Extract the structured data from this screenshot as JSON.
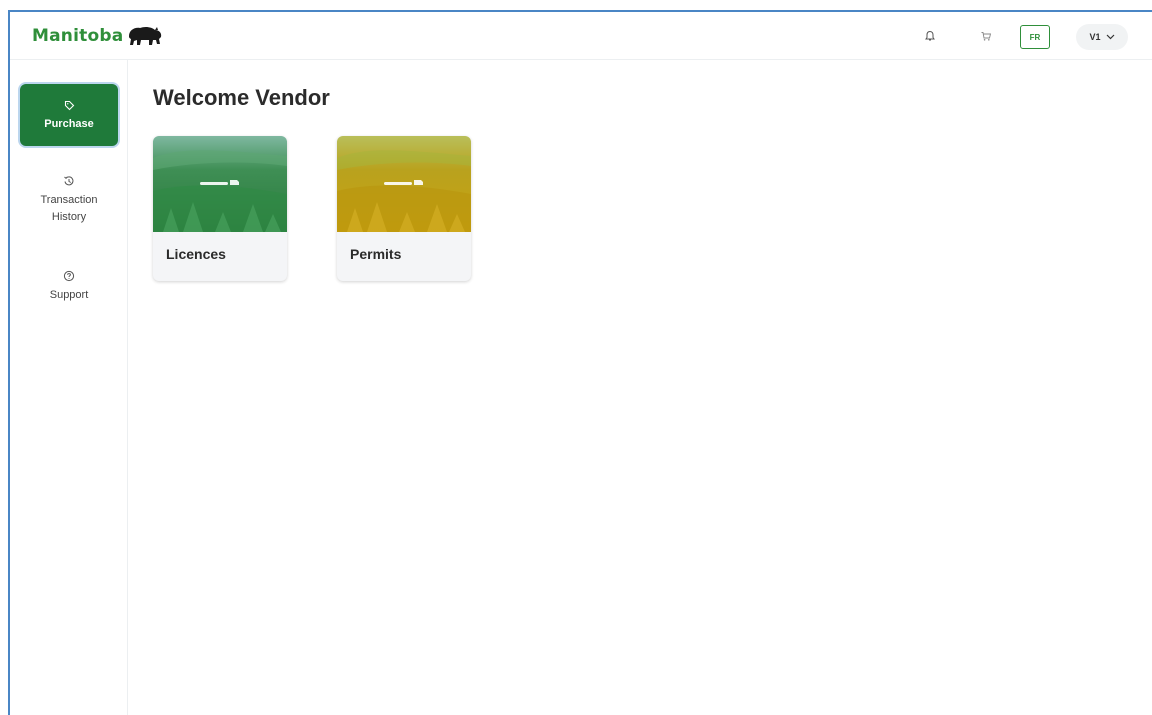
{
  "header": {
    "brand": "Manitoba",
    "bell_icon": "bell-icon",
    "cart_icon": "cart-icon",
    "language_button": "FR",
    "user_button": "V1"
  },
  "sidebar": {
    "items": [
      {
        "label": "Purchase",
        "icon": "tag-icon",
        "active": true
      },
      {
        "label": "Transaction History",
        "icon": "history-icon",
        "active": false
      },
      {
        "label": "Support",
        "icon": "help-icon",
        "active": false
      }
    ]
  },
  "main": {
    "title": "Welcome Vendor",
    "cards": [
      {
        "label": "Licences",
        "theme": "green"
      },
      {
        "label": "Permits",
        "theme": "yellow"
      }
    ]
  },
  "colors": {
    "brand_green": "#2f8f3a",
    "active_nav": "#1f7a3a",
    "frame_border": "#4a86c5"
  }
}
